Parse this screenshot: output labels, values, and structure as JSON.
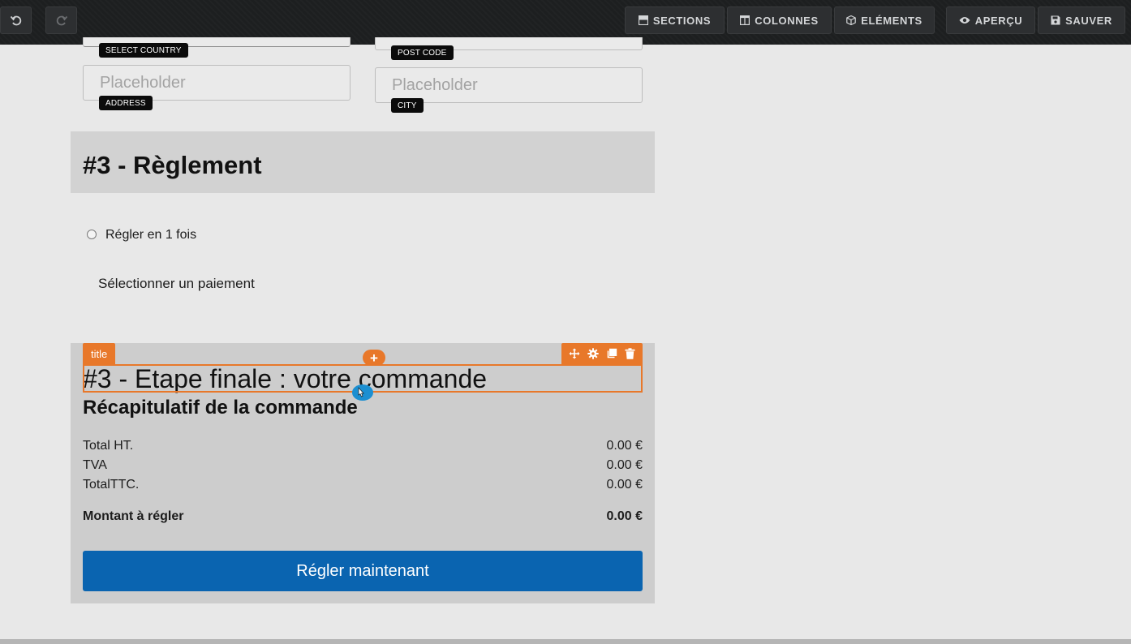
{
  "toolbar": {
    "undo_icon": "undo-icon",
    "redo_icon": "redo-icon",
    "sections_label": "SECTIONS",
    "columns_label": "COLONNES",
    "elements_label": "ELÉMENTS",
    "preview_label": "APERÇU",
    "save_label": "SAUVER"
  },
  "address_form": {
    "country_tag": "SELECT COUNTRY",
    "postcode_tag": "POST CODE",
    "address_placeholder": "Placeholder",
    "address_tag": "ADDRESS",
    "city_placeholder": "Placeholder",
    "city_tag": "CITY"
  },
  "payment_section": {
    "title": "#3 - Règlement",
    "option_label": "Régler en 1 fois",
    "select_text": "Sélectionner un paiement"
  },
  "editor": {
    "selection_tag": "title",
    "add_symbol": "+",
    "tool_icons": [
      "move-icon",
      "gear-icon",
      "duplicate-icon",
      "trash-icon"
    ],
    "accent_color": "#e8782a"
  },
  "final_section": {
    "title": "#3 - Etape finale : votre commande",
    "summary_title": "Récapitulatif de la commande",
    "rows": [
      {
        "label": "Total HT.",
        "value": "0.00 €"
      },
      {
        "label": "TVA",
        "value": "0.00 €"
      },
      {
        "label": "TotalTTC.",
        "value": "0.00 €"
      }
    ],
    "total": {
      "label": "Montant à régler",
      "value": "0.00 €"
    },
    "pay_button": "Régler maintenant",
    "pay_button_color": "#0a64b0"
  }
}
